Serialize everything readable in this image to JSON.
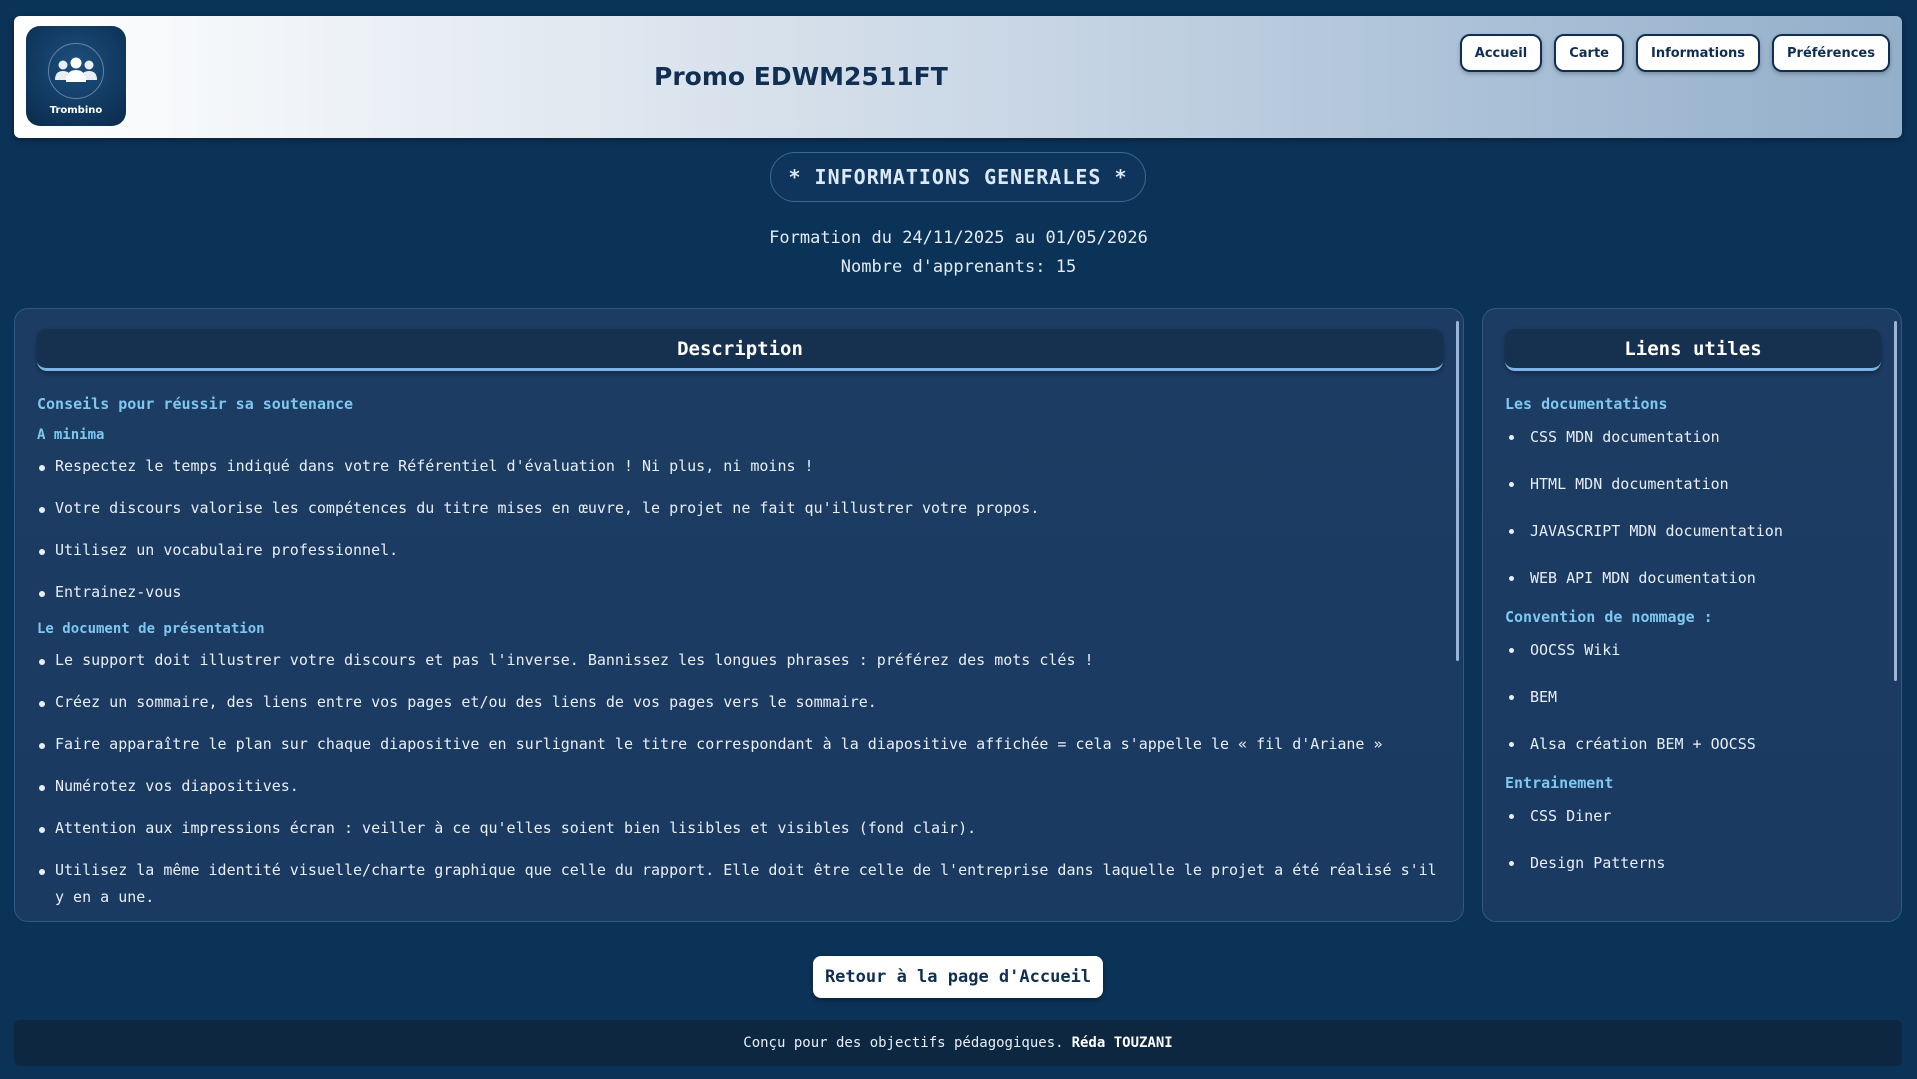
{
  "header": {
    "logo_text": "Trombino",
    "title": "Promo EDWM2511FT",
    "nav": [
      "Accueil",
      "Carte",
      "Informations",
      "Préférences"
    ]
  },
  "info": {
    "section_title": "* INFORMATIONS GENERALES *",
    "formation": "Formation du 24/11/2025 au 01/05/2026",
    "learners": "Nombre d'apprenants: 15"
  },
  "description": {
    "title": "Description",
    "heading": "Conseils pour réussir sa soutenance",
    "sections": [
      {
        "title": "A minima",
        "items": [
          "Respectez le temps indiqué dans votre Référentiel d'évaluation ! Ni plus, ni moins !",
          "Votre discours valorise les compétences du titre mises en œuvre, le projet ne fait qu'illustrer votre propos.",
          "Utilisez un vocabulaire professionnel.",
          "Entrainez-vous"
        ]
      },
      {
        "title": "Le document de présentation",
        "items": [
          "Le support doit illustrer votre discours et pas l'inverse. Bannissez les longues phrases : préférez des mots clés !",
          "Créez un sommaire, des liens entre vos pages et/ou des liens de vos pages vers le sommaire.",
          "Faire apparaître le plan sur chaque diapositive en surlignant le titre correspondant à la diapositive affichée = cela s'appelle le « fil d'Ariane »",
          "Numérotez vos diapositives.",
          "Attention aux impressions écran : veiller à ce qu'elles soient bien lisibles et visibles (fond clair).",
          "Utilisez la même identité visuelle/charte graphique que celle du rapport. Elle doit être celle de l'entreprise dans laquelle le projet a été réalisé s'il y en a une."
        ]
      }
    ]
  },
  "links": {
    "title": "Liens utiles",
    "groups": [
      {
        "title": "Les documentations",
        "items": [
          "CSS MDN documentation",
          "HTML MDN documentation",
          "JAVASCRIPT MDN documentation",
          "WEB API MDN documentation"
        ]
      },
      {
        "title": "Convention de nommage :",
        "items": [
          "OOCSS Wiki",
          "BEM",
          "Alsa création BEM + OOCSS"
        ]
      },
      {
        "title": "Entrainement",
        "items": [
          "CSS Diner",
          "Design Patterns"
        ]
      }
    ]
  },
  "back_button": "Retour à la page d'Accueil",
  "footer": {
    "text": "Conçu pour des objectifs pédagogiques.",
    "author": "Réda TOUZANI"
  },
  "colors": {
    "background": "#0b3257",
    "panel": "#1b3b62",
    "accent": "#7ec8f0",
    "dark_text": "#0f2f52"
  }
}
